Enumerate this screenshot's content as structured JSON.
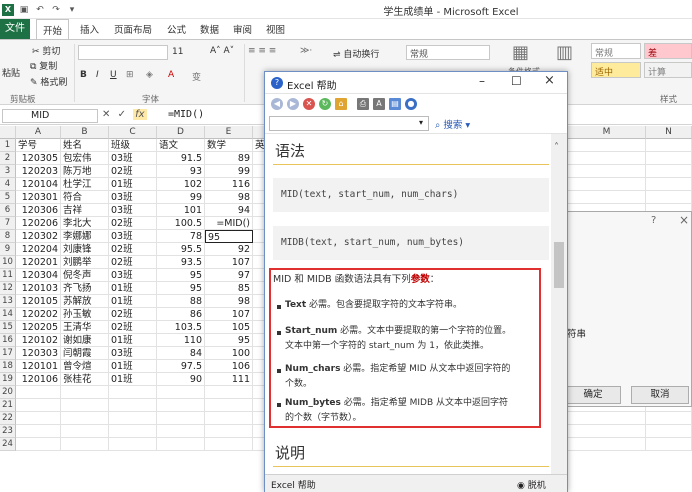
{
  "app": {
    "title": "学生成绩单 - Microsoft Excel"
  },
  "menu": [
    "文件",
    "开始",
    "插入",
    "页面布局",
    "公式",
    "数据",
    "审阅",
    "视图"
  ],
  "ribbon": {
    "cut": "剪切",
    "copy": "复制",
    "format_painter": "格式刷",
    "paste": "粘贴",
    "clipboard_group": "剪贴板",
    "font_group": "字体",
    "font_size": "11",
    "wrap_text": "自动换行",
    "number_format": "常规",
    "styles_group": "样式",
    "conditional_format": "条件格式",
    "style_normal": "常规",
    "style_bad": "差",
    "style_neutral": "适中",
    "style_calc": "计算"
  },
  "formula_bar": {
    "name_box": "MID",
    "fx": "fx",
    "formula": "=MID()"
  },
  "grid": {
    "columns": [
      "A",
      "B",
      "C",
      "D",
      "E",
      "M",
      "N"
    ],
    "headers": [
      "学号",
      "姓名",
      "班级",
      "语文",
      "数学",
      "英"
    ],
    "rows": [
      [
        "120305",
        "包宏伟",
        "03班",
        "91.5",
        "89"
      ],
      [
        "120203",
        "陈万地",
        "02班",
        "93",
        "99"
      ],
      [
        "120104",
        "杜学江",
        "01班",
        "102",
        "116"
      ],
      [
        "120301",
        "符合",
        "03班",
        "99",
        "98"
      ],
      [
        "120306",
        "吉祥",
        "03班",
        "101",
        "94"
      ],
      [
        "120206",
        "李北大",
        "02班",
        "100.5",
        "=MID()"
      ],
      [
        "120302",
        "李娜娜",
        "03班",
        "78",
        "95"
      ],
      [
        "120204",
        "刘康锋",
        "02班",
        "95.5",
        "92"
      ],
      [
        "120201",
        "刘鹏举",
        "02班",
        "93.5",
        "107"
      ],
      [
        "120304",
        "倪冬声",
        "03班",
        "95",
        "97"
      ],
      [
        "120103",
        "齐飞扬",
        "01班",
        "95",
        "85"
      ],
      [
        "120105",
        "苏解放",
        "01班",
        "88",
        "98"
      ],
      [
        "120202",
        "孙玉敏",
        "02班",
        "86",
        "107"
      ],
      [
        "120205",
        "王清华",
        "02班",
        "103.5",
        "105"
      ],
      [
        "120102",
        "谢如康",
        "01班",
        "110",
        "95"
      ],
      [
        "120303",
        "闫朝霞",
        "03班",
        "84",
        "100"
      ],
      [
        "120101",
        "曾令煊",
        "01班",
        "97.5",
        "106"
      ],
      [
        "120106",
        "张桂花",
        "01班",
        "90",
        "111"
      ]
    ],
    "row_numbers": [
      "1",
      "2",
      "3",
      "4",
      "5",
      "6",
      "7",
      "8",
      "9",
      "10",
      "11",
      "12",
      "13",
      "14",
      "15",
      "16",
      "17",
      "18",
      "19",
      "20",
      "21",
      "22",
      "23",
      "24"
    ]
  },
  "bg_dialog": {
    "help_q": "?",
    "close": "×",
    "partial_text": "符串",
    "ok": "确定",
    "cancel": "取消"
  },
  "help": {
    "title": "Excel 帮助",
    "search_label": "搜索",
    "heading_syntax": "语法",
    "code1": "MID(text, start_num, num_chars)",
    "code2": "MIDB(text, start_num, num_bytes)",
    "args_intro_a": "MID 和 MIDB 函数语法具有下列",
    "args_intro_b": "参数",
    "args_intro_c": "：",
    "args": [
      {
        "name": "Text",
        "l1": " 必需。包含要提取字符的文本字符串。",
        "l2": ""
      },
      {
        "name": "Start_num",
        "l1": " 必需。文本中要提取的第一个字符的位置。",
        "l2": "文本中第一个字符的 start_num 为 1，依此类推。"
      },
      {
        "name": "Num_chars",
        "l1": " 必需。指定希望 MID 从文本中返回字符的",
        "l2": "个数。"
      },
      {
        "name": "Num_bytes",
        "l1": " 必需。指定希望 MIDB 从文本中返回字符",
        "l2": "的个数（字节数）。"
      }
    ],
    "heading_desc": "说明",
    "status_left": "Excel 帮助",
    "status_right": "脱机"
  },
  "colors": {
    "excel_green": "#1e7145",
    "highlight_red": "#e03030",
    "rule_gold": "#e9c45a"
  }
}
